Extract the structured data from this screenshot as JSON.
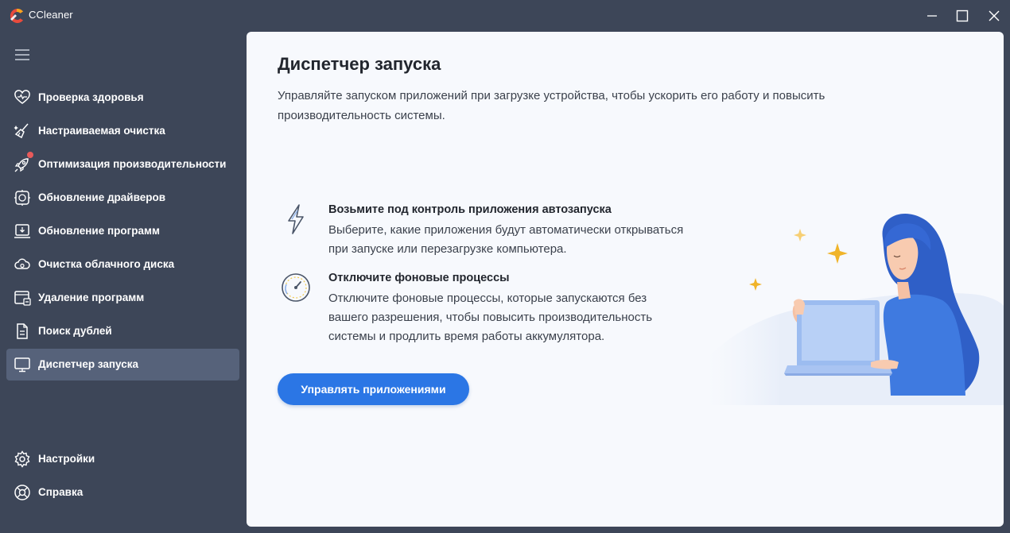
{
  "window": {
    "title": "CCleaner",
    "controls": [
      "minimize",
      "maximize",
      "close"
    ]
  },
  "sidebar": {
    "items": [
      {
        "label": "Проверка здоровья",
        "icon": "heart-icon"
      },
      {
        "label": "Настраиваемая очистка",
        "icon": "broom-icon"
      },
      {
        "label": "Оптимизация производительности",
        "icon": "rocket-icon"
      },
      {
        "label": "Обновление драйверов",
        "icon": "driver-icon"
      },
      {
        "label": "Обновление программ",
        "icon": "software-update-icon"
      },
      {
        "label": "Очистка облачного диска",
        "icon": "cloud-icon"
      },
      {
        "label": "Удаление программ",
        "icon": "uninstall-icon"
      },
      {
        "label": "Поиск дублей",
        "icon": "duplicate-icon"
      },
      {
        "label": "Диспетчер запуска",
        "icon": "monitor-icon",
        "active": true
      }
    ],
    "bottom_items": [
      {
        "label": "Настройки",
        "icon": "gear-icon"
      },
      {
        "label": "Справка",
        "icon": "help-icon"
      }
    ]
  },
  "main": {
    "title": "Диспетчер запуска",
    "description": "Управляйте запуском приложений при загрузке устройства, чтобы ускорить его работу и повысить производительность системы.",
    "features": [
      {
        "icon": "lightning-icon",
        "title": "Возьмите под контроль приложения автозапуска",
        "description": "Выберите, какие приложения будут автоматически открываться при запуске или перезагрузке компьютера."
      },
      {
        "icon": "speedometer-icon",
        "title": "Отключите фоновые процессы",
        "description": "Отключите фоновые процессы, которые запускаются без вашего разрешения, чтобы повысить производительность системы и продлить время работы аккумулятора."
      }
    ],
    "button_label": "Управлять приложениями"
  },
  "colors": {
    "window_bg": "#3d4658",
    "active_item_bg": "#56627a",
    "content_bg": "#f7f9fd",
    "accent": "#2b76e5",
    "badge": "#e85a5a"
  }
}
